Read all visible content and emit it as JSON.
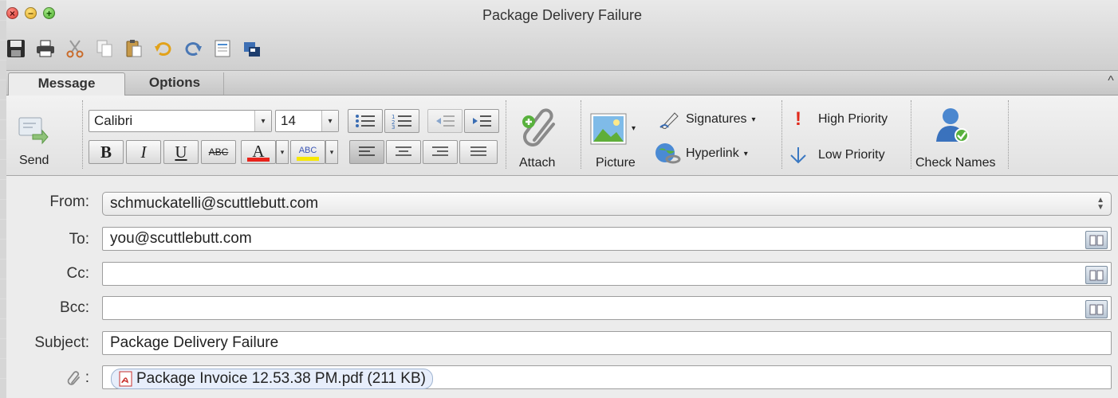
{
  "window": {
    "title": "Package Delivery Failure"
  },
  "traffic_lights": {
    "close_glyph": "×",
    "minimize_glyph": "−",
    "zoom_glyph": "+"
  },
  "quick_toolbar": {
    "icons": [
      "save-icon",
      "print-icon",
      "cut-icon",
      "copy-icon",
      "paste-icon",
      "undo-icon",
      "redo-icon",
      "message-options-icon",
      "customize-toolbar-icon"
    ]
  },
  "tabs": {
    "message": "Message",
    "options": "Options",
    "collapse_glyph": "^"
  },
  "ribbon": {
    "send": "Send",
    "font_name": "Calibri",
    "font_size": "14",
    "bold": "B",
    "italic": "I",
    "underline": "U",
    "strike": "ABC",
    "font_color_letter": "A",
    "highlight_text": "ABC",
    "attach": "Attach",
    "picture": "Picture",
    "signatures": "Signatures",
    "hyperlink": "Hyperlink",
    "high_priority": "High Priority",
    "low_priority": "Low Priority",
    "check_names": "Check Names",
    "dropdown_glyph": "▾",
    "colors": {
      "font_color_bar": "#e8231b",
      "highlight_bar": "#f6e700",
      "priority_high": "#e12a1c",
      "priority_low": "#3a78c2"
    }
  },
  "form": {
    "from": {
      "label": "From:",
      "value": "schmuckatelli@scuttlebutt.com"
    },
    "to": {
      "label": "To:",
      "value": "you@scuttlebutt.com"
    },
    "cc": {
      "label": "Cc:",
      "value": ""
    },
    "bcc": {
      "label": "Bcc:",
      "value": ""
    },
    "subject": {
      "label": "Subject:",
      "value": "Package Delivery Failure"
    },
    "attachment": {
      "label_suffix": ":",
      "file": "Package Invoice 12.53.38 PM.pdf (211 KB)"
    }
  }
}
